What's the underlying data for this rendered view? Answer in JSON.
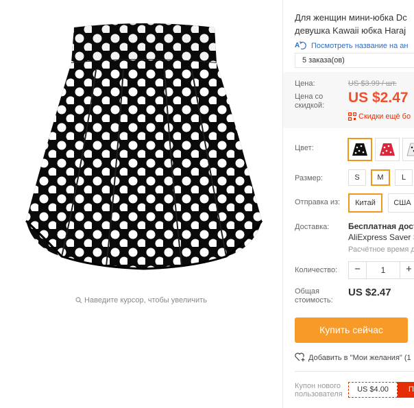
{
  "image_pane": {
    "zoom_hint": "Наведите курсор, чтобы увеличить"
  },
  "product": {
    "title_line1": "Для женщин мини-юбка Dc",
    "title_line2": "девушка Kawaii юбка Haraj",
    "translate_link": "Посмотреть название на ан",
    "orders": "5 заказа(ов)"
  },
  "price": {
    "price_label": "Цена:",
    "old_price": "US $3.99 / шт.",
    "discount_label": "Цена со скидкой:",
    "new_price": "US $2.47",
    "per_unit_slash": "/",
    "extra_discount": "Скидки ещё бо"
  },
  "options": {
    "color_label": "Цвет:",
    "size_label": "Размер:",
    "sizes": [
      "S",
      "M",
      "L"
    ],
    "selected_size": "M",
    "ship_from_label": "Отправка из:",
    "ship_from": [
      "Китай",
      "США"
    ],
    "selected_ship_from": "Китай"
  },
  "delivery": {
    "label": "Доставка:",
    "title": "Бесплатная доста",
    "method": "AliExpress Saver S",
    "time": "Расчётное время д"
  },
  "quantity": {
    "label": "Количество:",
    "minus": "−",
    "value": "1",
    "plus": "+"
  },
  "total": {
    "label": "Общая стоимость:",
    "value": "US $2.47"
  },
  "actions": {
    "buy_now": "Купить сейчас",
    "wishlist": "Добавить в \"Мои желания\" (1"
  },
  "coupon": {
    "label": "Купон нового пользователя",
    "amount": "US $4.00",
    "cta": "П"
  },
  "colors": {
    "accent": "#f79a27",
    "price_red": "#f04f2c",
    "selected_border": "#f0961a",
    "link_blue": "#2d6dc4"
  }
}
